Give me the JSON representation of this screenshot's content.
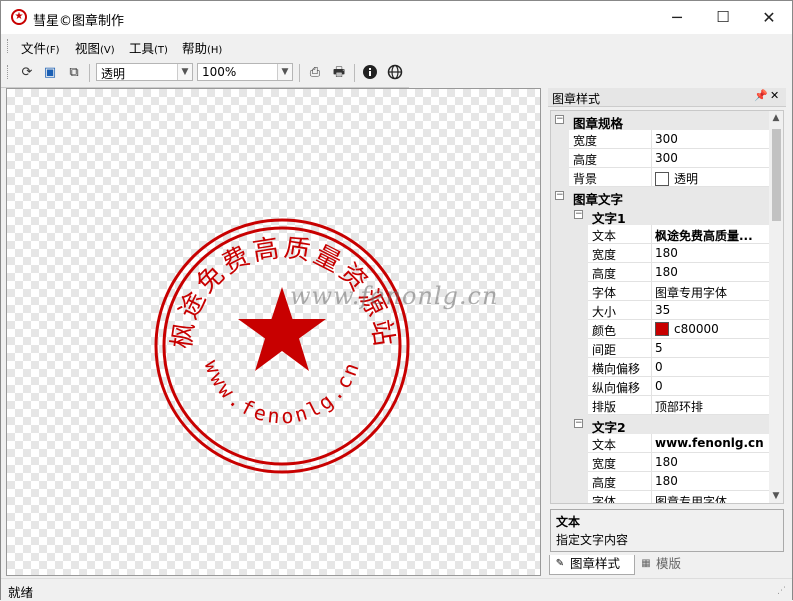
{
  "window": {
    "title": "彗星©图章制作",
    "minimize": "─",
    "maximize": "☐",
    "close": "✕"
  },
  "menu": {
    "items": [
      {
        "label": "文件",
        "accel": "(F)"
      },
      {
        "label": "视图",
        "accel": "(V)"
      },
      {
        "label": "工具",
        "accel": "(T)"
      },
      {
        "label": "帮助",
        "accel": "(H)"
      }
    ]
  },
  "toolbar": {
    "background_value": "透明",
    "zoom_value": "100%",
    "icons": [
      "refresh-icon",
      "save-icon",
      "copy-icon",
      "export-icon",
      "print-icon",
      "info-icon",
      "globe-icon"
    ]
  },
  "seal": {
    "color": "#c80000",
    "top_text": "枫途免费高质量资源站",
    "bottom_text": "www.fenonlg.cn"
  },
  "watermark": "www.fenonlg.cn",
  "panel": {
    "title": "图章样式",
    "pin": "ㅁ",
    "close": "✕",
    "categories": {
      "spec": "图章规格",
      "text": "图章文字",
      "text1": "文字1",
      "text2": "文字2"
    },
    "spec_props": [
      {
        "name": "宽度",
        "value": "300"
      },
      {
        "name": "高度",
        "value": "300"
      },
      {
        "name": "背景",
        "value": "透明"
      }
    ],
    "text1_props": [
      {
        "name": "文本",
        "value": "枫途免费高质量..."
      },
      {
        "name": "宽度",
        "value": "180"
      },
      {
        "name": "高度",
        "value": "180"
      },
      {
        "name": "字体",
        "value": "图章专用字体"
      },
      {
        "name": "大小",
        "value": "35"
      },
      {
        "name": "颜色",
        "value": "c80000"
      },
      {
        "name": "间距",
        "value": "5"
      },
      {
        "name": "横向偏移",
        "value": "0"
      },
      {
        "name": "纵向偏移",
        "value": "0"
      },
      {
        "name": "排版",
        "value": "顶部环排"
      }
    ],
    "text2_props": [
      {
        "name": "文本",
        "value": "www.fenonlg.cn"
      },
      {
        "name": "宽度",
        "value": "180"
      },
      {
        "name": "高度",
        "value": "180"
      },
      {
        "name": "字体",
        "value": "图章专用字体"
      }
    ],
    "description": {
      "title": "文本",
      "text": "指定文字内容"
    },
    "tabs": [
      {
        "label": "图章样式",
        "active": true
      },
      {
        "label": "模版",
        "active": false
      }
    ]
  },
  "status": {
    "text": "就绪"
  }
}
